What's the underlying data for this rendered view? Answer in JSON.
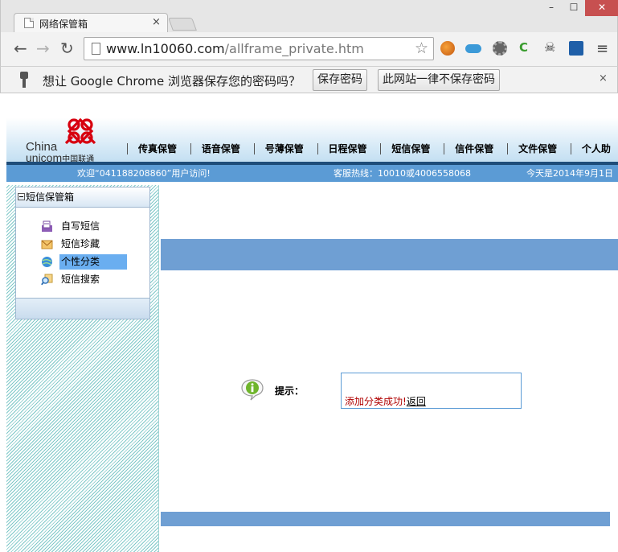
{
  "browser": {
    "tab_title": "网络保管箱",
    "tab_close": "×",
    "window_controls": {
      "minimize": "–",
      "maximize": "☐",
      "close": "✕"
    },
    "url_host": "www.ln10060.com",
    "url_path": "/allframe_private.htm",
    "nav": {
      "back": "←",
      "forward": "→",
      "reload": "↻"
    },
    "star": "☆",
    "menu": "≡",
    "extensions": [
      "orange-globe-icon",
      "cloud-icon",
      "gear-extension-icon",
      "c-extension-icon",
      "mask-extension-icon",
      "blue-extension-icon"
    ]
  },
  "infobar": {
    "text": "想让 Google Chrome 浏览器保存您的密码吗？",
    "save_label": "保存密码",
    "never_label": "此网站一律不保存密码",
    "close": "×"
  },
  "site": {
    "logo": {
      "line1": "China",
      "line2": "unicom",
      "cn": "中国联通"
    },
    "nav_items": [
      "传真保管",
      "语音保管",
      "号薄保管",
      "日程保管",
      "短信保管",
      "信件保管",
      "文件保管",
      "个人助"
    ],
    "welcome": "欢迎“041188208860”用户访问!",
    "hotline": "客服热线：10010或4006558068",
    "today": "今天是2014年9月1日"
  },
  "sidebar": {
    "title": "短信保管箱",
    "items": [
      {
        "label": "自写短信",
        "icon": "write-sms-icon"
      },
      {
        "label": "短信珍藏",
        "icon": "collection-envelope-icon"
      },
      {
        "label": "个性分类",
        "icon": "category-globe-icon",
        "active": true
      },
      {
        "label": "短信搜索",
        "icon": "search-magnifier-icon"
      }
    ]
  },
  "main": {
    "tip_label": "提示：",
    "message": "添加分类成功!",
    "back_link": "返回"
  },
  "colors": {
    "band": "#6f9fd3",
    "infostrip": "#5b9bd5",
    "active_item": "#6aaef0",
    "success_text": "#b00000",
    "logo_red": "#d7000f"
  }
}
